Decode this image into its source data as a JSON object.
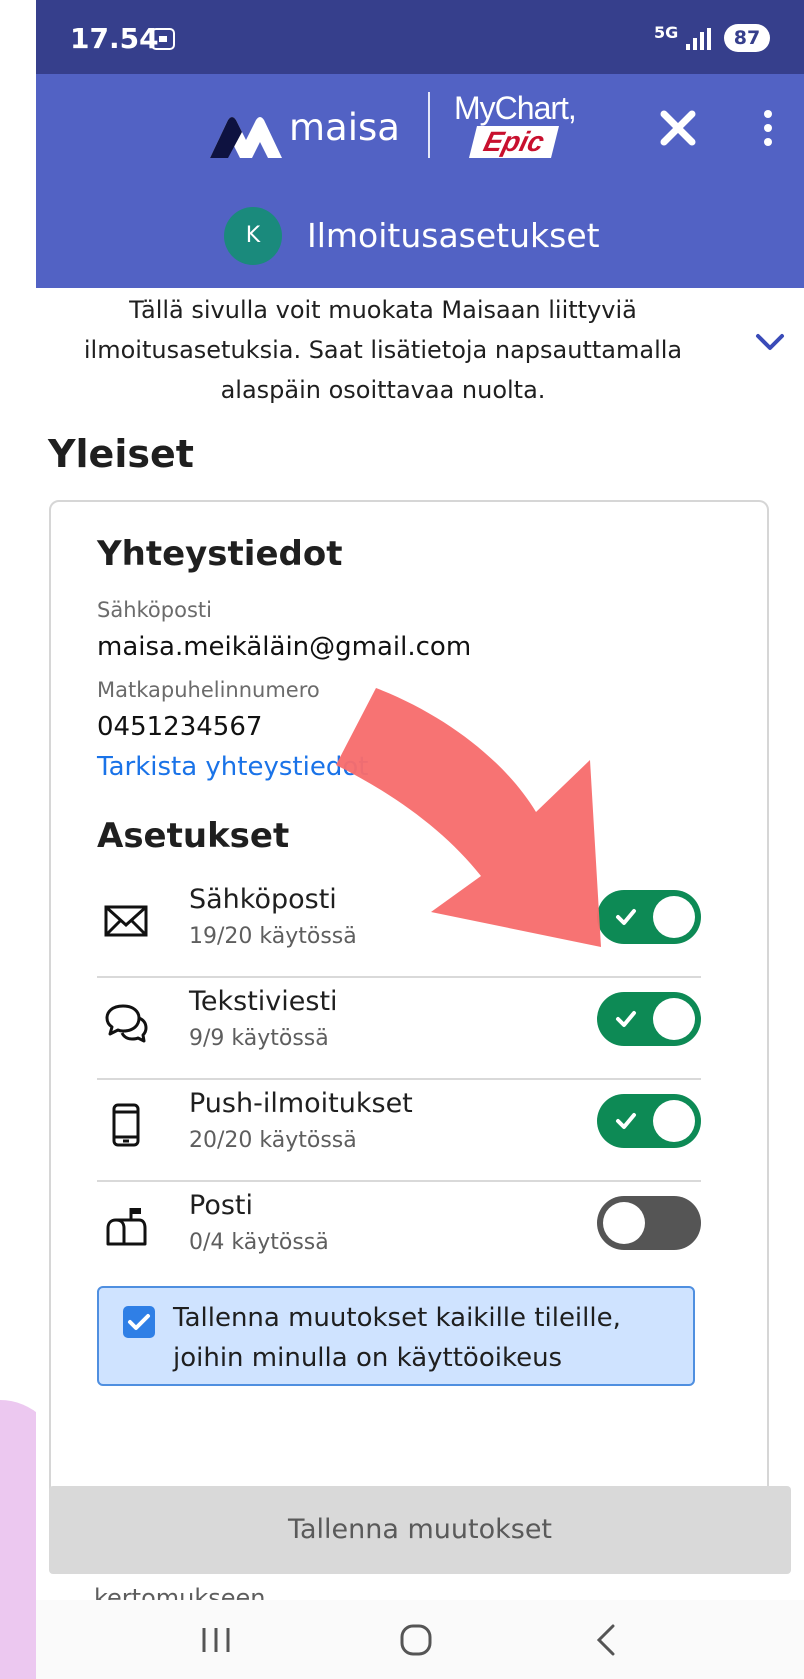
{
  "status_bar": {
    "time": "17.54",
    "network": "5G",
    "battery": "87"
  },
  "header": {
    "brand": "maisa",
    "partner_line1": "MyChart,",
    "partner_line2": "Epic",
    "avatar_initial": "K",
    "title": "Ilmoitusasetukset"
  },
  "intro": {
    "text": "Tällä sivulla voit muokata Maisaan liittyviä ilmoitusasetuksia. Saat lisätietoja napsauttamalla alaspäin osoittavaa nuolta."
  },
  "section_title": "Yleiset",
  "contact": {
    "title": "Yhteystiedot",
    "email_label": "Sähköposti",
    "email_value": "maisa.meikäläin@gmail.com",
    "phone_label": "Matkapuhelinnumero",
    "phone_value": "0451234567",
    "verify_link": "Tarkista yhteystiedot"
  },
  "settings": {
    "title": "Asetukset",
    "rows": [
      {
        "icon": "envelope-icon",
        "title": "Sähköposti",
        "subtitle": "19/20 käytössä",
        "enabled": true
      },
      {
        "icon": "chat-bubbles-icon",
        "title": "Tekstiviesti",
        "subtitle": "9/9 käytössä",
        "enabled": true
      },
      {
        "icon": "phone-icon",
        "title": "Push-ilmoitukset",
        "subtitle": "20/20 käytössä",
        "enabled": true
      },
      {
        "icon": "mailbox-icon",
        "title": "Posti",
        "subtitle": "0/4 käytössä",
        "enabled": false
      }
    ],
    "apply_all_checked": true,
    "apply_all_text": "Tallenna muutokset kaikille tileille, joihin minulla on käyttöoikeus"
  },
  "save_button": "Tallenna muutokset",
  "peek_text": "kertomukseen",
  "colors": {
    "status_bar": "#363f8c",
    "header": "#5262c4",
    "toggle_on": "#0d8a55",
    "toggle_off": "#555555",
    "link": "#1a73e8",
    "annotation_arrow": "#f76d6d"
  }
}
